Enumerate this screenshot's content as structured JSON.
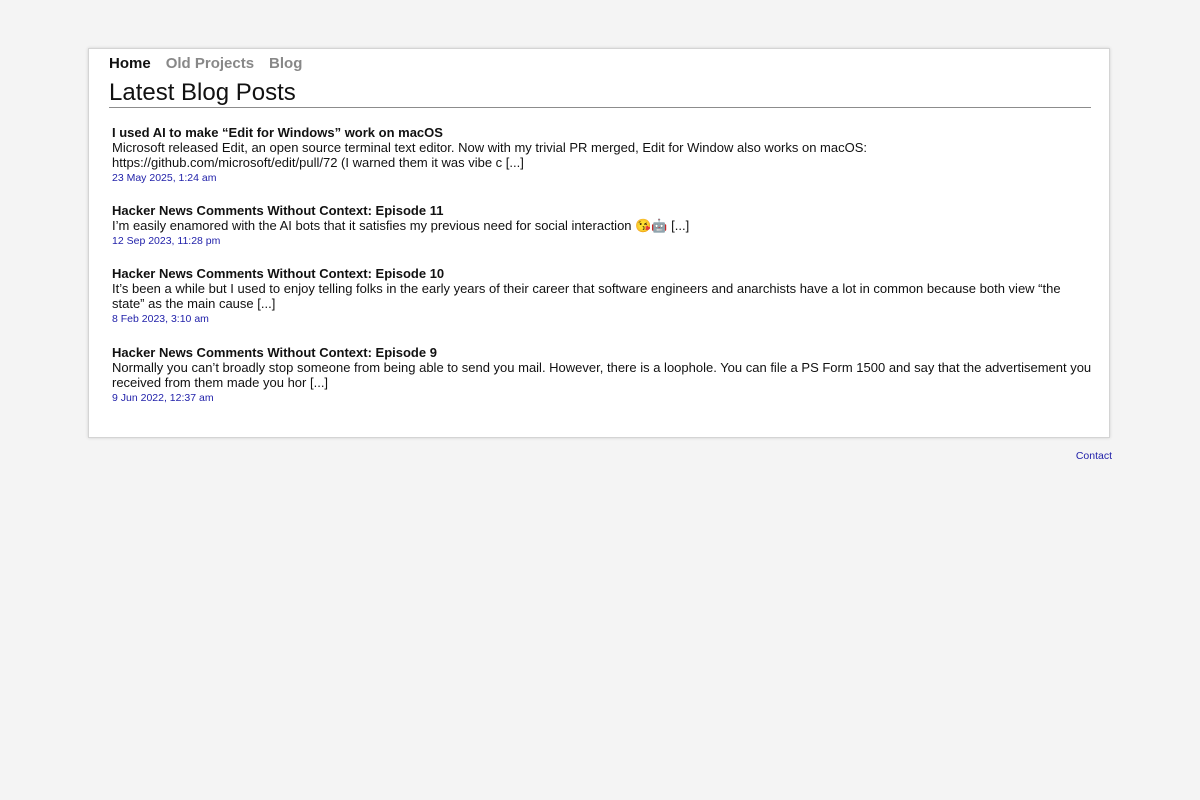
{
  "nav": {
    "items": [
      {
        "label": "Home",
        "active": true
      },
      {
        "label": "Old Projects",
        "active": false
      },
      {
        "label": "Blog",
        "active": false
      }
    ]
  },
  "page": {
    "title": "Latest Blog Posts"
  },
  "posts": [
    {
      "title": "I used AI to make “Edit for Windows” work on macOS",
      "excerpt": "Microsoft released Edit, an open source terminal text editor. Now with my trivial PR merged, Edit for Window also works on macOS: https://github.com/microsoft/edit/pull/72 (I warned them it was vibe c [...]",
      "date": "23 May 2025, 1:24 am"
    },
    {
      "title": "Hacker News Comments Without Context: Episode 11",
      "excerpt": "I’m easily enamored with the AI bots that it satisfies my previous need for social interaction 😘🤖 [...]",
      "date": "12 Sep 2023, 11:28 pm"
    },
    {
      "title": "Hacker News Comments Without Context: Episode 10",
      "excerpt": "It’s been a while but I used to enjoy telling folks in the early years of their career that software engineers and anarchists have a lot in common because both view “the state” as the main cause [...]",
      "date": "8 Feb 2023, 3:10 am"
    },
    {
      "title": "Hacker News Comments Without Context: Episode 9",
      "excerpt": "Normally you can’t broadly stop someone from being able to send you mail. However, there is a loophole. You can file a PS Form 1500 and say that the advertisement you received from them made you hor [...]",
      "date": "9 Jun 2022, 12:37 am"
    }
  ],
  "footer": {
    "contact_label": "Contact"
  }
}
